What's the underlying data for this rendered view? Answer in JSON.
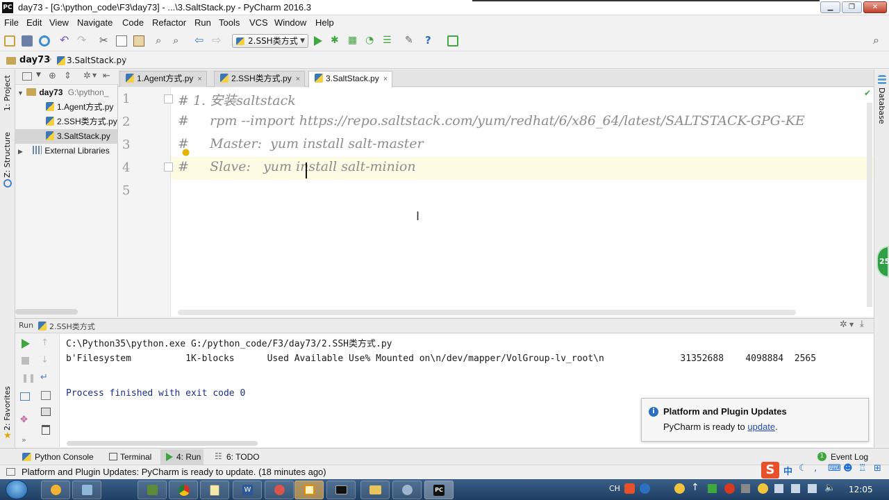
{
  "window": {
    "title": "day73 - [G:\\python_code\\F3\\day73] - ...\\3.SaltStack.py - PyCharm 2016.3",
    "app_icon": "PC",
    "minimize": "▁",
    "maximize": "❐",
    "close": "✕"
  },
  "menu": [
    "File",
    "Edit",
    "View",
    "Navigate",
    "Code",
    "Refactor",
    "Run",
    "Tools",
    "VCS",
    "Window",
    "Help"
  ],
  "toolbar": {
    "run_config": "2.SSH类方式"
  },
  "breadcrumb": {
    "project": "day73",
    "file": "3.SaltStack.py"
  },
  "side_left": {
    "project": "1: Project",
    "structure": "Z: Structure",
    "favorites": "2: Favorites"
  },
  "side_right": {
    "database": "Database"
  },
  "project_tree": {
    "root": "day73",
    "root_path": "G:\\python_",
    "files": [
      "1.Agent方式.py",
      "2.SSH类方式.py",
      "3.SaltStack.py"
    ],
    "libs": "External Libraries"
  },
  "tabs": [
    "1.Agent方式.py",
    "2.SSH类方式.py",
    "3.SaltStack.py"
  ],
  "tab_close": "×",
  "editor": {
    "line_numbers": [
      "1",
      "2",
      "3",
      "4",
      "5"
    ],
    "lines": [
      "# 1. 安装saltstack",
      "#     rpm --import https://repo.saltstack.com/yum/redhat/6/x86_64/latest/SALTSTACK-GPG-KE",
      "#     Master:  yum install salt-master",
      "#     Slave:   yum install salt-minion",
      ""
    ]
  },
  "run_header": {
    "label": "Run",
    "config": "2.SSH类方式"
  },
  "run_output": [
    "C:\\Python35\\python.exe G:/python_code/F3/day73/2.SSH类方式.py",
    "b'Filesystem          1K-blocks      Used Available Use% Mounted on\\n/dev/mapper/VolGroup-lv_root\\n              31352688    4098884  2565",
    "",
    "Process finished with exit code 0"
  ],
  "notification": {
    "title": "Platform and Plugin Updates",
    "body": "PyCharm is ready to",
    "link": "update",
    "end": "."
  },
  "bottom_tabs": {
    "python_console": "Python Console",
    "terminal": "Terminal",
    "run": "4: Run",
    "todo": "6: TODO",
    "event_log": "Event Log"
  },
  "status": "Platform and Plugin Updates: PyCharm is ready to update. (18 minutes ago)",
  "badge": "25",
  "taskbar": {
    "clock": "12:05",
    "lang": "CH",
    "ime": "中"
  },
  "colors": {
    "run_green": "#3ea83e",
    "link_blue": "#2249b8",
    "comment_gray": "#8c8c8c",
    "output_blue": "#1a2e8a"
  }
}
